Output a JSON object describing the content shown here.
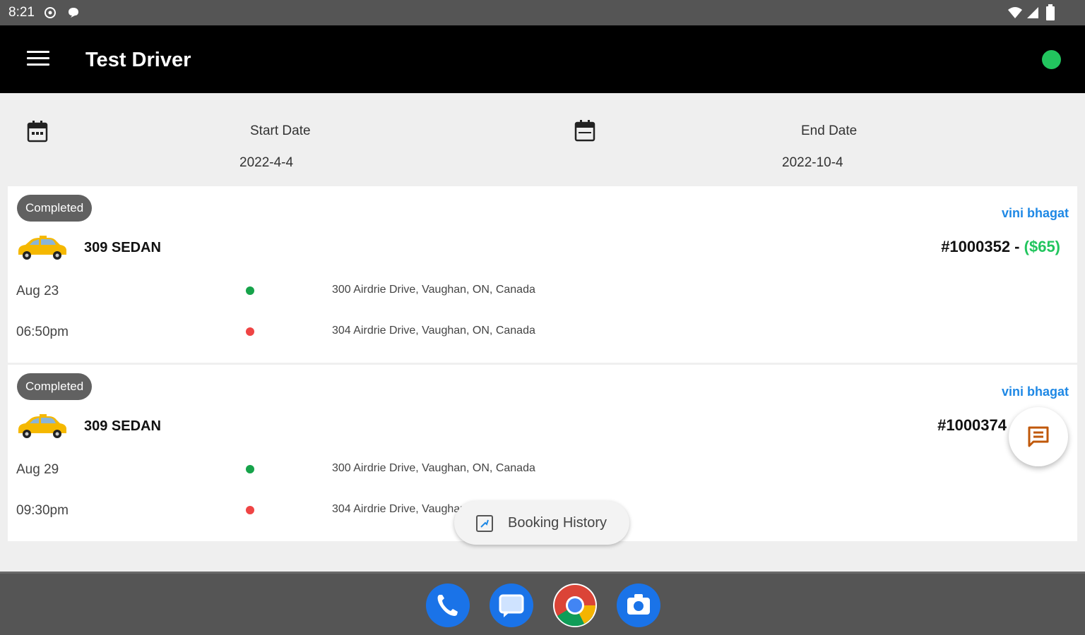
{
  "status_bar": {
    "time": "8:21"
  },
  "app_bar": {
    "title": "Test Driver",
    "online_color": "#22c55e"
  },
  "filters": {
    "start_label": "Start Date",
    "start_value": "2022-4-4",
    "end_label": "End Date",
    "end_value": "2022-10-4"
  },
  "bookings": [
    {
      "status": "Completed",
      "driver": "vini bhagat",
      "vehicle": "309 SEDAN",
      "order": "#1000352 -",
      "price": "($65)",
      "date": "Aug 23",
      "time": "06:50pm",
      "pickup": "300 Airdrie Drive, Vaughan, ON, Canada",
      "dropoff": "304 Airdrie Drive, Vaughan, ON, Canada"
    },
    {
      "status": "Completed",
      "driver": "vini bhagat",
      "vehicle": "309 SEDAN",
      "order": "#1000374",
      "date": "Aug 29",
      "time": "09:30pm",
      "pickup": "300 Airdrie Drive, Vaughan, ON, Canada",
      "dropoff": "304 Airdrie Drive, Vaughan"
    }
  ],
  "booking_history_label": "Booking History",
  "dock": [
    {
      "icon": "phone-icon",
      "color": "#1a73e8"
    },
    {
      "icon": "messages-icon",
      "color": "#1a73e8"
    },
    {
      "icon": "chrome-icon",
      "color": "#34a853"
    },
    {
      "icon": "camera-icon",
      "color": "#1a73e8"
    }
  ]
}
